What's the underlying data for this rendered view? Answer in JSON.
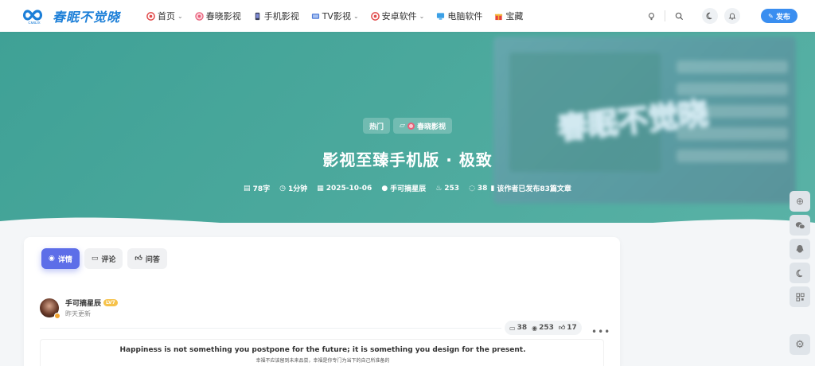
{
  "header": {
    "logo_text": "春眠不觉晓",
    "logo_sub": "CMBJX",
    "nav": [
      {
        "label": "首页",
        "icon": "target-icon",
        "dropdown": true
      },
      {
        "label": "春晓影视",
        "icon": "candy-icon",
        "dropdown": false
      },
      {
        "label": "手机影视",
        "icon": "phone-icon",
        "dropdown": false
      },
      {
        "label": "TV影视",
        "icon": "tv-icon",
        "dropdown": true
      },
      {
        "label": "安卓软件",
        "icon": "target-icon",
        "dropdown": true
      },
      {
        "label": "电脑软件",
        "icon": "monitor-icon",
        "dropdown": false
      },
      {
        "label": "宝藏",
        "icon": "gift-icon",
        "dropdown": false
      }
    ],
    "publish_label": "发布"
  },
  "banner": {
    "tags": [
      "热门",
      "春晓影视"
    ],
    "title": "影视至臻手机版 · 极致",
    "meta": {
      "words": "78字",
      "read_time": "1分钟",
      "date": "2025-10-06",
      "author": "手可摘星辰",
      "views": "253",
      "comments": "38",
      "posts": "该作者已发布83篇文章"
    }
  },
  "tabs": [
    {
      "label": "详情",
      "active": true
    },
    {
      "label": "评论",
      "active": false
    },
    {
      "label": "问答",
      "active": false
    }
  ],
  "author": {
    "name": "手可摘星辰",
    "level": "LV7",
    "updated": "昨天更新"
  },
  "stats": {
    "comments": "38",
    "views": "253",
    "likes": "17"
  },
  "quote": {
    "en": "Happiness is not something you postpone for the future; it is something you design for the present.",
    "zh": "幸福不应该留到未来品尝，幸福是你专门为当下的自己所准备的"
  },
  "colors": {
    "banner": "#4aa89c",
    "accent": "#5d6ee8",
    "publish": "#3a8ef0"
  }
}
